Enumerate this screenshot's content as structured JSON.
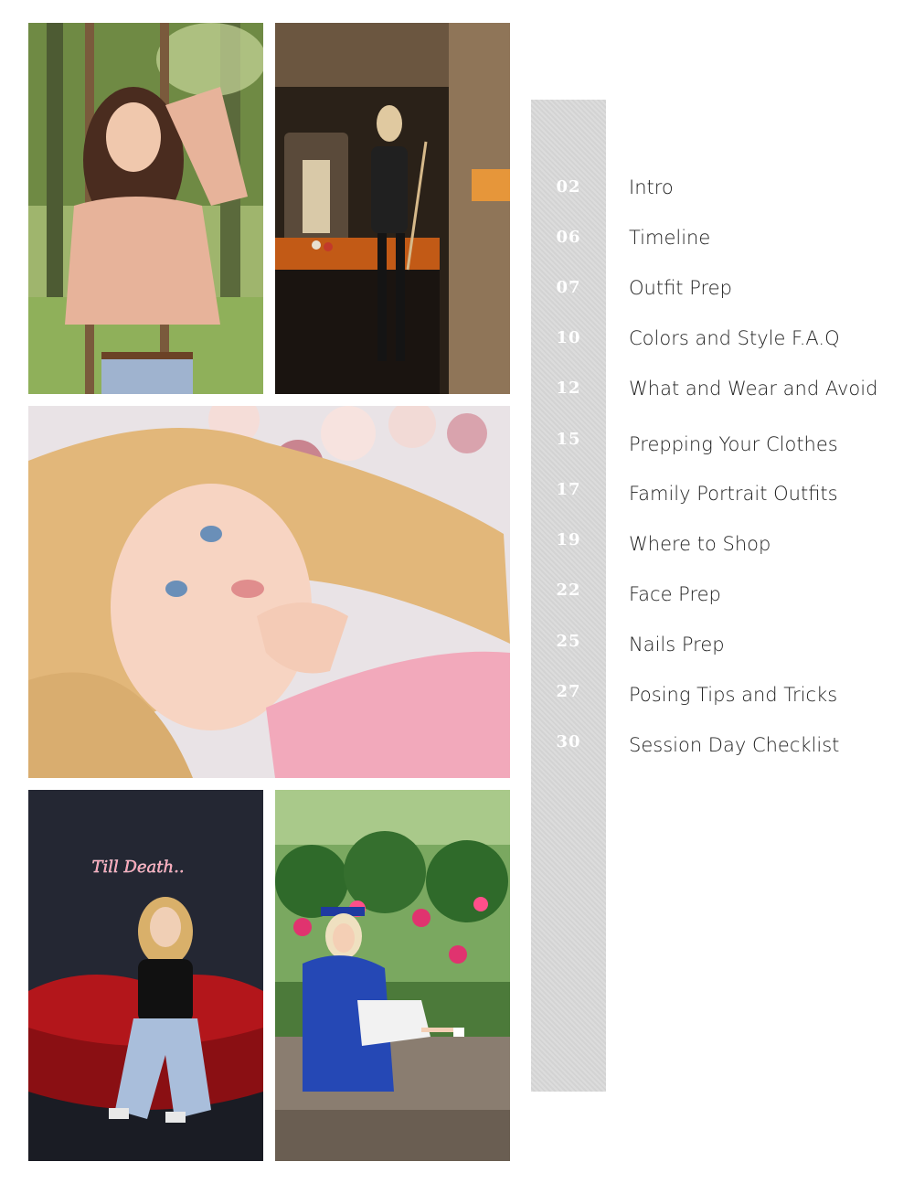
{
  "photos": [
    {
      "alt": "Senior portrait in woods with peach blouse"
    },
    {
      "alt": "Senior portrait at pool table"
    },
    {
      "alt": "Close-up portrait lying among pink roses"
    },
    {
      "alt": "Senior portrait on red lips couch under neon sign"
    },
    {
      "alt": "Graduation portrait in blue cap and gown by flowers"
    }
  ],
  "neon_sign": "Till Death..",
  "toc": [
    {
      "num": "02",
      "title": "Intro"
    },
    {
      "num": "06",
      "title": "Timeline"
    },
    {
      "num": "07",
      "title": "Outfit Prep"
    },
    {
      "num": "10",
      "title": "Colors and Style F.A.Q"
    },
    {
      "num": "12",
      "title": "What and Wear and Avoid"
    },
    {
      "num": "15",
      "title": "Prepping Your Clothes"
    },
    {
      "num": "17",
      "title": "Family Portrait Outfits"
    },
    {
      "num": "19",
      "title": "Where to Shop"
    },
    {
      "num": "22",
      "title": "Face Prep"
    },
    {
      "num": "25",
      "title": "Nails Prep"
    },
    {
      "num": "27",
      "title": "Posing Tips and Tricks"
    },
    {
      "num": "30",
      "title": "Session Day Checklist"
    }
  ]
}
